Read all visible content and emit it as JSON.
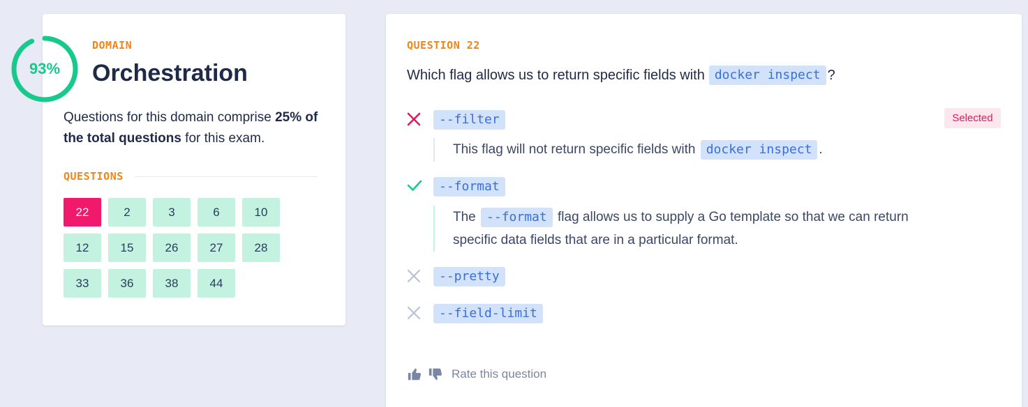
{
  "domain": {
    "progress_percent": 93,
    "progress_label": "93%",
    "eyebrow": "DOMAIN",
    "title": "Orchestration",
    "description_pre": "Questions for this domain comprise ",
    "description_bold": "25% of the total questions",
    "description_post": " for this exam.",
    "questions_label": "QUESTIONS",
    "questions": [
      "22",
      "2",
      "3",
      "6",
      "10",
      "12",
      "15",
      "26",
      "27",
      "28",
      "33",
      "36",
      "38",
      "44"
    ],
    "current_question": "22"
  },
  "question": {
    "eyebrow": "QUESTION 22",
    "text_pre": "Which flag allows us to return specific fields with",
    "text_code": "docker inspect",
    "text_post": "?",
    "options": [
      {
        "label": "--filter",
        "status": "incorrect-selected",
        "icon": "x-icon",
        "explanation_pre": "This flag will not return specific fields with",
        "explanation_code": "docker inspect",
        "explanation_post": "."
      },
      {
        "label": "--format",
        "status": "correct",
        "icon": "check-icon",
        "explanation_pre": "The",
        "explanation_code": "--format",
        "explanation_post_line1": "flag allows us to supply a Go template so that we can return",
        "explanation_line2": "specific data fields that are in a particular format."
      },
      {
        "label": "--pretty",
        "status": "incorrect",
        "icon": "x-icon"
      },
      {
        "label": "--field-limit",
        "status": "incorrect",
        "icon": "x-icon"
      }
    ],
    "selected_badge": "Selected",
    "rate_label": "Rate this question"
  },
  "colors": {
    "background": "#e8ebf5",
    "accent_orange": "#f08519",
    "progress_green": "#17c98a",
    "current_pink": "#f0196b",
    "question_tile": "#c3f2e1",
    "code_bg": "#d3e2fb",
    "code_text": "#3a6fd8",
    "incorrect_red": "#e2195f",
    "muted_x": "#b8c2d6"
  }
}
